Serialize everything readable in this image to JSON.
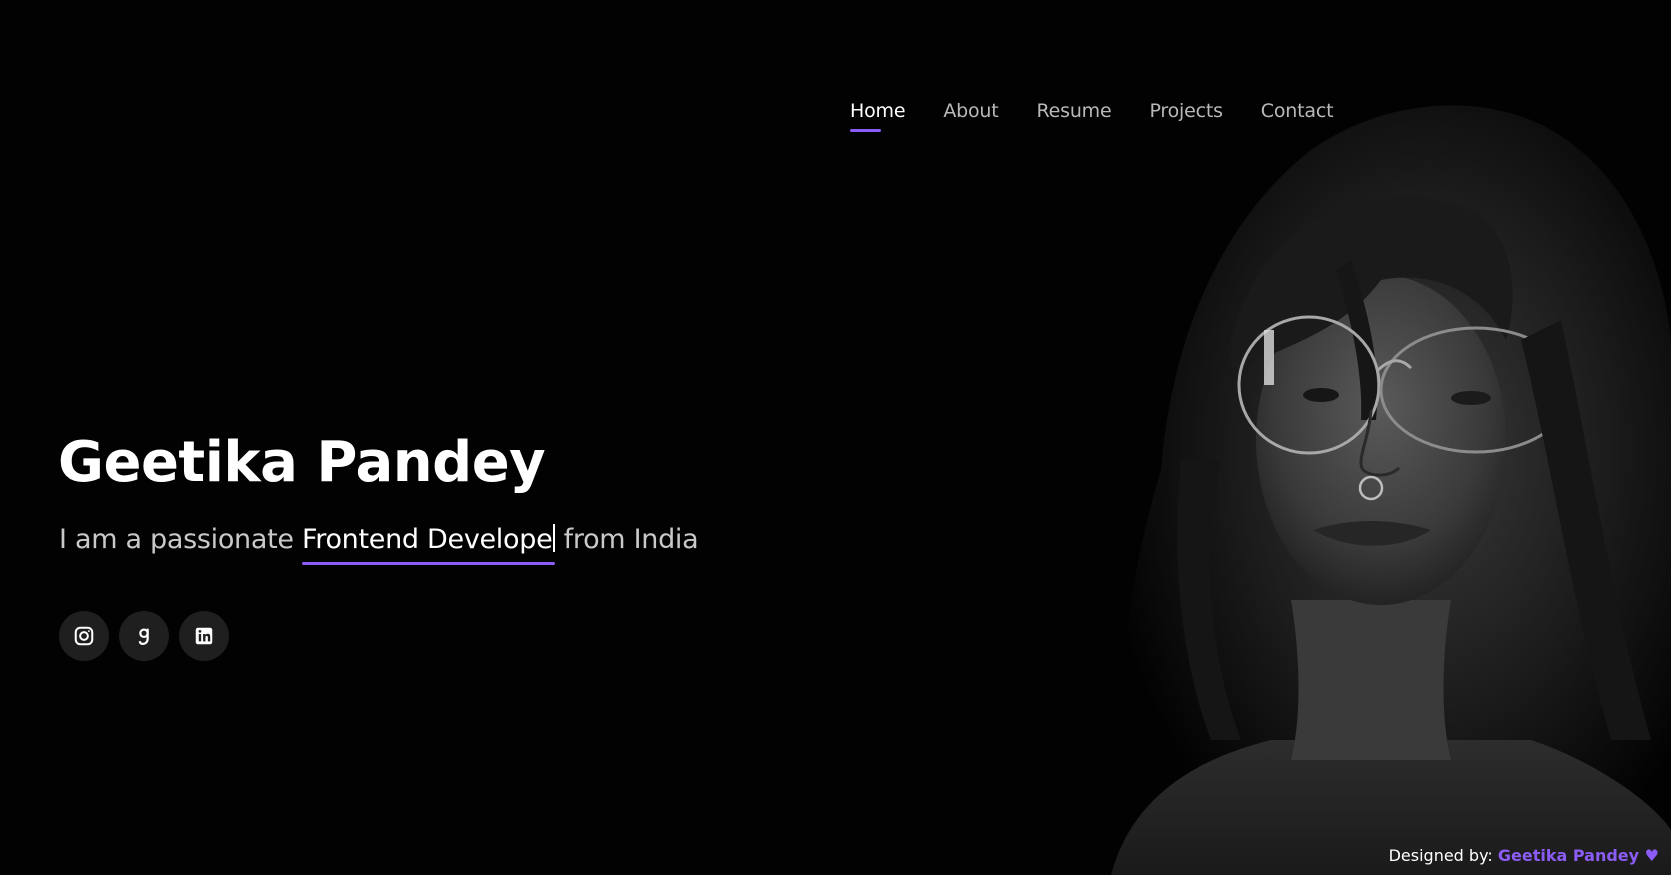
{
  "nav": {
    "items": [
      {
        "label": "Home",
        "active": true
      },
      {
        "label": "About",
        "active": false
      },
      {
        "label": "Resume",
        "active": false
      },
      {
        "label": "Projects",
        "active": false
      },
      {
        "label": "Contact",
        "active": false
      }
    ]
  },
  "hero": {
    "name": "Geetika Pandey",
    "tagline_prefix": "I am a passionate ",
    "typed_role": "Frontend Develope",
    "tagline_suffix": " from India"
  },
  "socials": [
    {
      "name": "instagram",
      "icon": "instagram-icon"
    },
    {
      "name": "goodreads",
      "icon": "goodreads-icon"
    },
    {
      "name": "linkedin",
      "icon": "linkedin-icon"
    }
  ],
  "footer": {
    "designed_by_label": "Designed by:",
    "author": "Geetika Pandey",
    "heart": "♥"
  },
  "colors": {
    "background": "#020202",
    "accent": "#8b5cf6",
    "text": "#ffffff",
    "muted_text": "#c9c9c9",
    "icon_bg": "#1f1f1f"
  }
}
